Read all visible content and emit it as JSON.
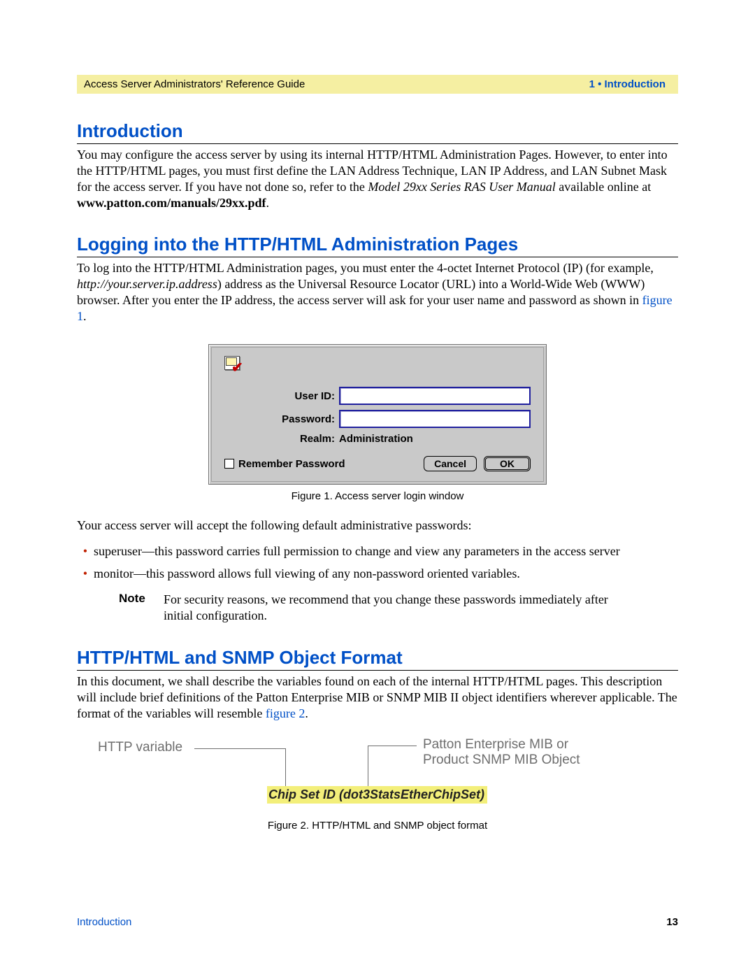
{
  "header": {
    "left": "Access Server Administrators' Reference Guide",
    "right": "1 • Introduction"
  },
  "sections": {
    "intro": {
      "heading": "Introduction",
      "para_a": "You may configure the access server by using its internal HTTP/HTML Administration Pages. However, to enter into the HTTP/HTML pages, you must first define the LAN Address Technique, LAN IP Address, and LAN Subnet Mask for the access server. If you have not done so, refer to the ",
      "para_italic": "Model 29xx Series RAS User Manual",
      "para_b": " available online at ",
      "para_bold": "www.patton.com/manuals/29xx.pdf",
      "para_c": "."
    },
    "login": {
      "heading": "Logging into the HTTP/HTML Administration Pages",
      "para_a": "To log into the HTTP/HTML Administration pages, you must enter the 4-octet Internet Protocol (IP) (for example, ",
      "para_italic": "http://your.server.ip.address",
      "para_b": ") address as the Universal Resource Locator (URL) into a World-Wide Web (WWW) browser. After you enter the IP address, the access server will ask for your user name and password as shown in ",
      "para_link": "figure 1",
      "para_c": ".",
      "dialog": {
        "user_label": "User ID:",
        "pass_label": "Password:",
        "realm_label": "Realm:",
        "realm_value": "Administration",
        "remember": "Remember Password",
        "cancel": "Cancel",
        "ok": "OK"
      },
      "caption": "Figure 1. Access server login window",
      "after": "Your access server will accept the following default administrative passwords:",
      "bullets": [
        "superuser—this password carries full permission to change and view any parameters in the access server",
        "monitor—this password allows full viewing of any non-password oriented variables."
      ],
      "note_label": "Note",
      "note_body": "For security reasons, we recommend that you change these passwords immediately after initial configuration."
    },
    "snmp": {
      "heading": "HTTP/HTML and SNMP Object Format",
      "para_a": "In this document, we shall describe the variables found on each of the internal HTTP/HTML pages. This description will include brief definitions of the Patton Enterprise MIB or SNMP MIB II object identifiers wherever applicable. The format of the variables will resemble ",
      "para_link": "figure 2",
      "para_b": ".",
      "fig2": {
        "left_label": "HTTP variable",
        "right_label_line1": "Patton Enterprise MIB or",
        "right_label_line2": "Product SNMP MIB Object",
        "mib": "Chip Set ID (dot3StatsEtherChipSet)"
      },
      "caption": "Figure 2. HTTP/HTML and SNMP object format"
    }
  },
  "footer": {
    "left": "Introduction",
    "right": "13"
  }
}
